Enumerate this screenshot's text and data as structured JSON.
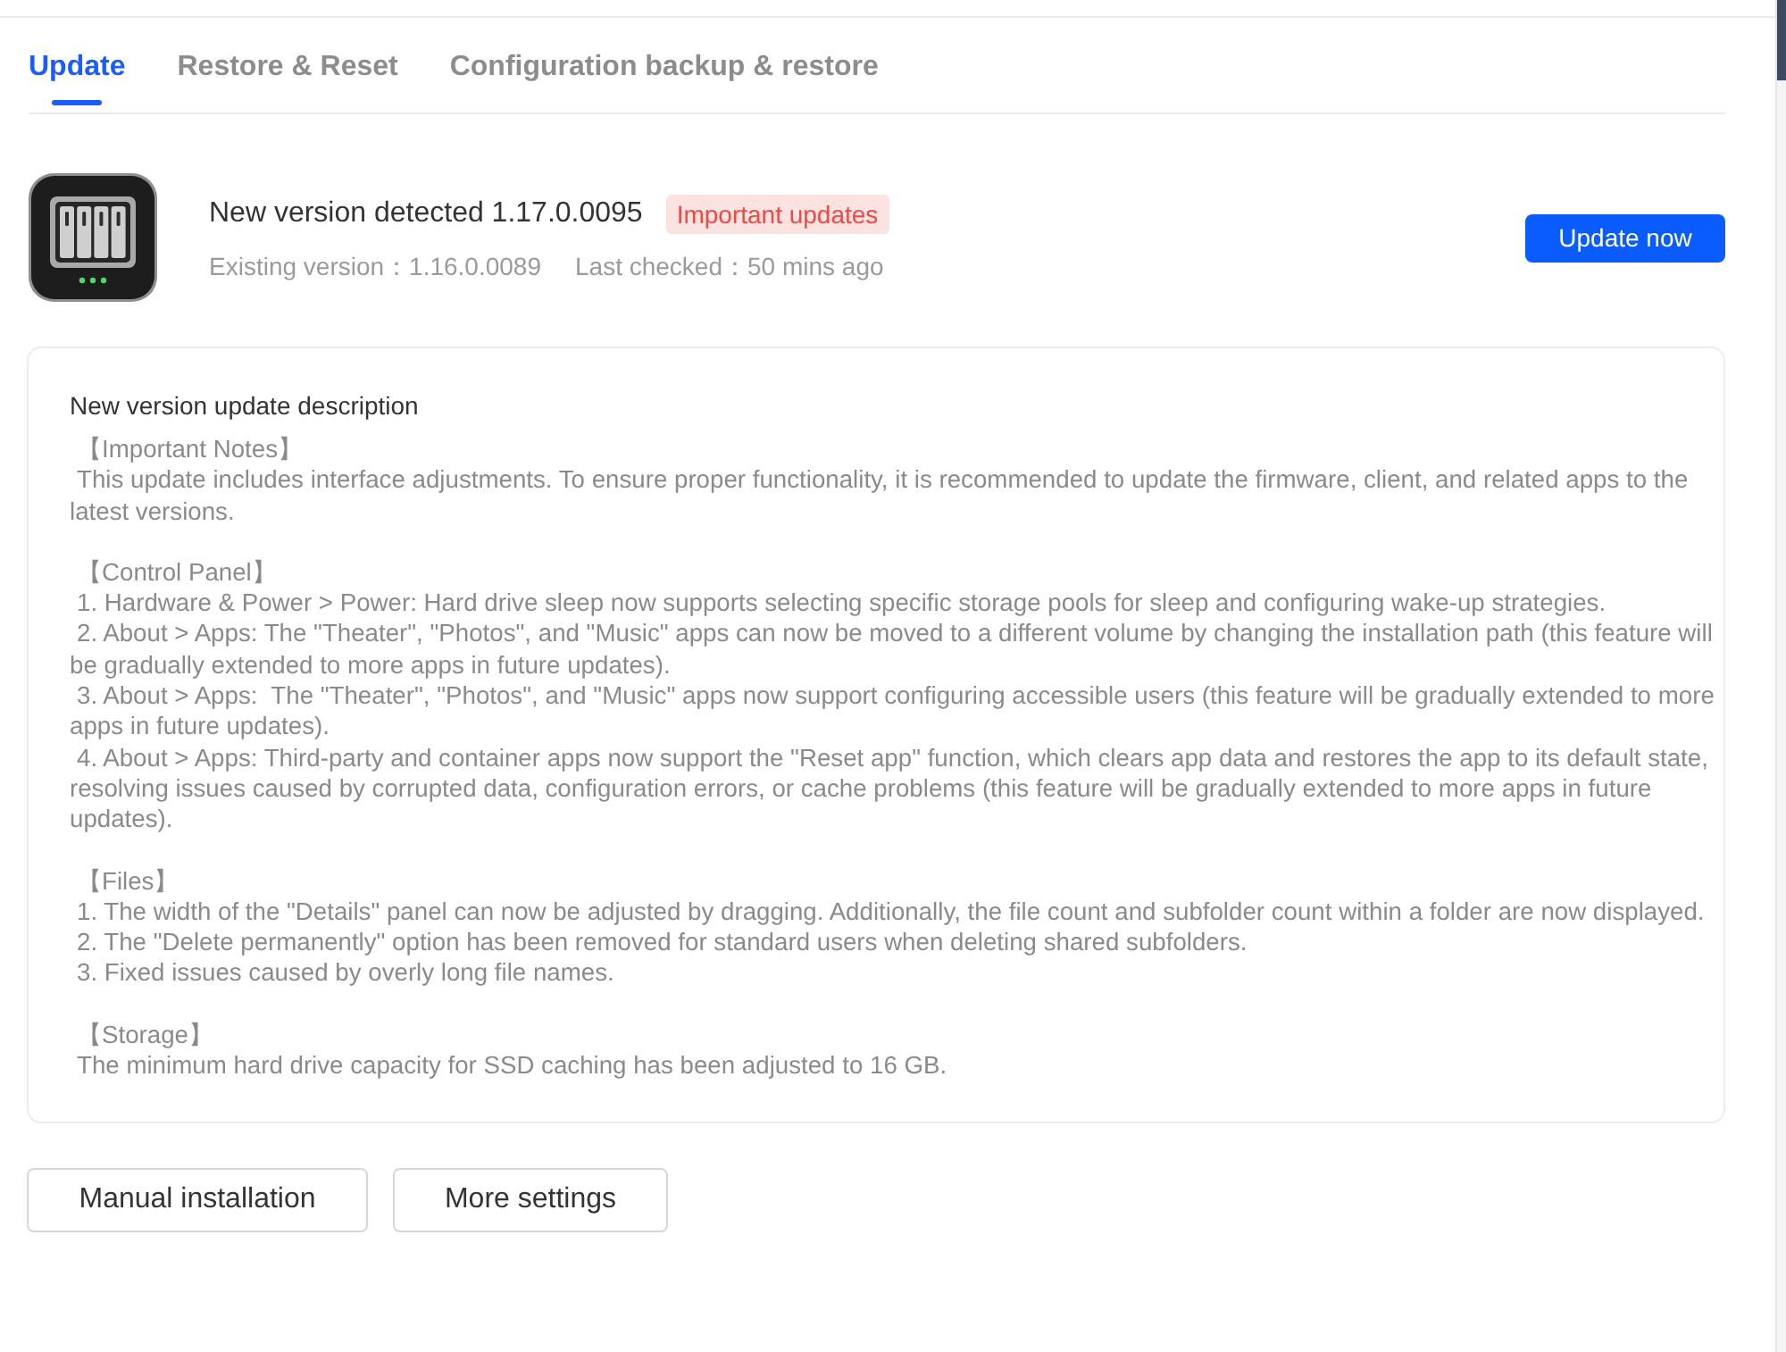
{
  "tabs": [
    {
      "label": "Update",
      "selected": true
    },
    {
      "label": "Restore & Reset",
      "selected": false
    },
    {
      "label": "Configuration backup & restore",
      "selected": false
    }
  ],
  "update": {
    "title": "New version detected 1.17.0.0095",
    "badge": "Important updates",
    "existing_version": "Existing version：1.16.0.0089",
    "last_checked": "Last checked：50 mins ago",
    "button": "Update now"
  },
  "description": {
    "title": "New version update description",
    "sections": [
      {
        "heading": "【Important Notes】",
        "lines": [
          "This update includes interface adjustments. To ensure proper functionality, it is recommended to update the firmware, client, and related apps to the latest versions."
        ]
      },
      {
        "heading": "【Control Panel】",
        "lines": [
          "1. Hardware & Power > Power: Hard drive sleep now supports selecting specific storage pools for sleep and configuring wake-up strategies.",
          "2. About > Apps: The \"Theater\", \"Photos\", and \"Music\" apps can now be moved to a different volume by changing the installation path (this feature will be gradually extended to more apps in future updates).",
          "3. About > Apps:  The \"Theater\", \"Photos\", and \"Music\" apps now support configuring accessible users (this feature will be gradually extended to more apps in future updates).",
          "4. About > Apps: Third-party and container apps now support the \"Reset app\" function, which clears app data and restores the app to its default state, resolving issues caused by corrupted data, configuration errors, or cache problems (this feature will be gradually extended to more apps in future updates)."
        ]
      },
      {
        "heading": "【Files】",
        "lines": [
          "1. The width of the \"Details\" panel can now be adjusted by dragging. Additionally, the file count and subfolder count within a folder are now displayed.",
          "2. The \"Delete permanently\" option has been removed for standard users when deleting shared subfolders.",
          "3. Fixed issues caused by overly long file names."
        ]
      },
      {
        "heading": "【Storage】",
        "lines": [
          "The minimum hard drive capacity for SSD caching has been adjusted to 16 GB."
        ]
      }
    ]
  },
  "buttons": [
    "Manual installation",
    "More settings"
  ]
}
